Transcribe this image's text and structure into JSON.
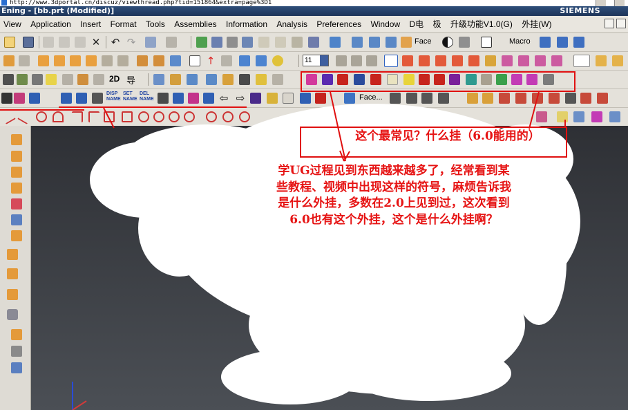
{
  "address_bar": {
    "url": "http://www.3dportal.cn/discuz/viewthread.php?tid=151864&extra=page%3D1"
  },
  "window": {
    "title": "Ening - [bb.prt (Modified)]",
    "brand": "SIEMENS"
  },
  "menu": {
    "items": [
      "View",
      "Application",
      "Insert",
      "Format",
      "Tools",
      "Assemblies",
      "Information",
      "Analysis",
      "Preferences",
      "Window",
      "D电",
      "极",
      "升级功能V1.0(G)",
      "外挂(W)"
    ]
  },
  "toolbar": {
    "face_dropdown": "Face",
    "macro_label": "Macro",
    "layer_value": "11",
    "label_2d": "2D",
    "label_dao": "导",
    "label_face_dots": "Face...",
    "nc_labels": [
      "DISP NAME",
      "SET NAME",
      "DEL NAME"
    ]
  },
  "annotations": {
    "box_note": "这个最常见？什么挂（6.0能用的）",
    "question": "学UG过程见到东西越来越多了，经常看到某些教程、视频中出现这样的符号，麻烦告诉我是什么外挂，多数在2.0上见到过，这次看到6.0也有这个外挂，这个是什么外挂啊？"
  },
  "colors": {
    "annotation_red": "#e61414",
    "toolbar_bg": "#e4e1da",
    "viewport_top": "#2e3035"
  }
}
